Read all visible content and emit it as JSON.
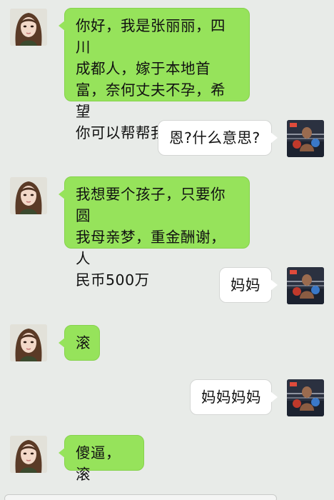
{
  "conversation": {
    "messages": [
      {
        "side": "left",
        "text": "你好，我是张丽丽，四川\n成都人，嫁于本地首\n富，奈何丈夫不孕，希望\n你可以帮帮我"
      },
      {
        "side": "right",
        "text": "恩?什么意思?"
      },
      {
        "side": "left",
        "text": "我想要个孩子，只要你圆\n我母亲梦，重金酬谢，人\n民币500万"
      },
      {
        "side": "right",
        "text": "妈妈"
      },
      {
        "side": "left",
        "text": "滚"
      },
      {
        "side": "right",
        "text": "妈妈妈妈"
      },
      {
        "side": "left",
        "text": "傻逼，滚"
      }
    ]
  },
  "avatars": {
    "contact": "woman-portrait-avatar",
    "self": "boxer-in-ring-avatar"
  },
  "colors": {
    "background": "#e8ebe8",
    "outgoing_bubble": "#96e35b",
    "incoming_bubble": "#ffffff",
    "text": "#111111"
  }
}
